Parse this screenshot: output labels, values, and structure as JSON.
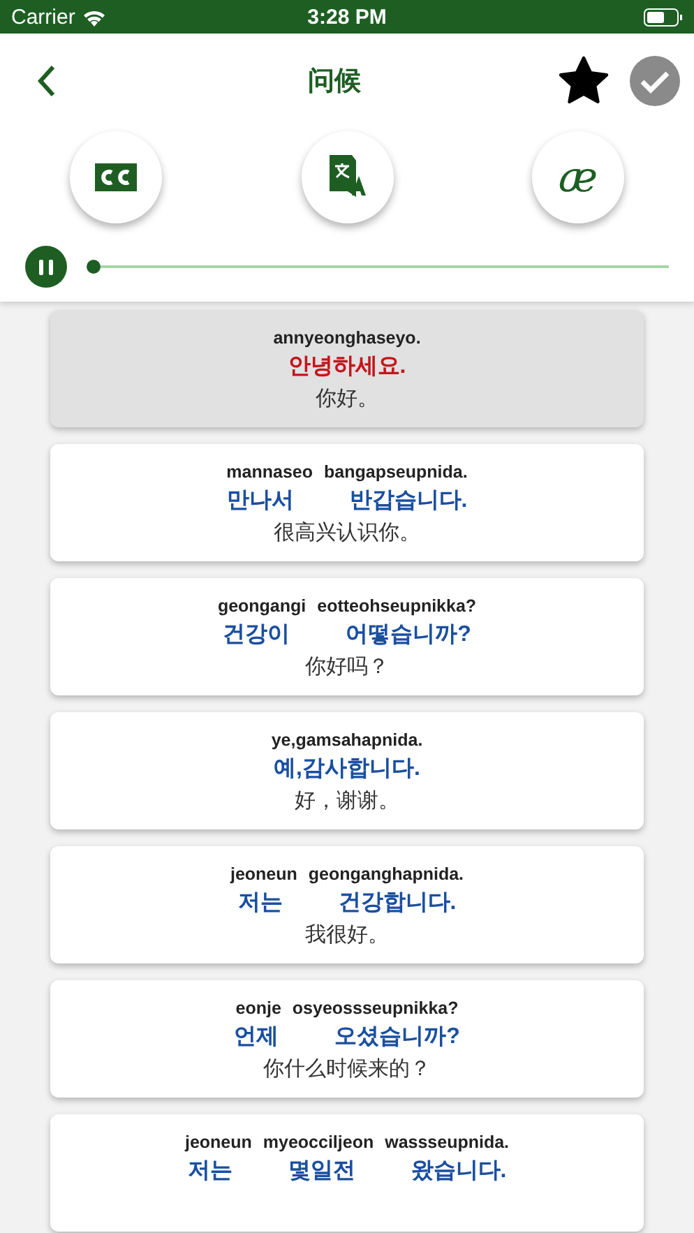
{
  "status_bar": {
    "carrier": "Carrier",
    "time": "3:28 PM"
  },
  "header": {
    "title": "问候",
    "favorite": true,
    "complete_disabled": true
  },
  "tools": [
    {
      "kind": "captions"
    },
    {
      "kind": "translate"
    },
    {
      "kind": "phonetic",
      "label": "æ"
    }
  ],
  "player": {
    "playing": true,
    "level": 0
  },
  "phrases": [
    {
      "selected": true,
      "romanization": [
        "annyeonghaseyo."
      ],
      "korean": [
        "안녕하세요."
      ],
      "translation": "你好。"
    },
    {
      "selected": false,
      "romanization": [
        "mannaseo",
        "bangapseupnida."
      ],
      "korean": [
        "만나서",
        "반갑습니다."
      ],
      "translation": "很高兴认识你。"
    },
    {
      "selected": false,
      "romanization": [
        "geongangi",
        "eotteohseupnikka?"
      ],
      "korean": [
        "건강이",
        "어떻습니까?"
      ],
      "translation": "你好吗？"
    },
    {
      "selected": false,
      "romanization": [
        "ye,gamsahapnida."
      ],
      "korean": [
        "예,감사합니다."
      ],
      "translation": "好，谢谢。"
    },
    {
      "selected": false,
      "romanization": [
        "jeoneun",
        "geonganghapnida."
      ],
      "korean": [
        "저는",
        "건강합니다."
      ],
      "translation": "我很好。"
    },
    {
      "selected": false,
      "romanization": [
        "eonje",
        "osyeossseupnikka?"
      ],
      "korean": [
        "언제",
        "오셨습니까?"
      ],
      "translation": "你什么时候来的？"
    },
    {
      "selected": false,
      "romanization": [
        "jeoneun",
        "myeocciljeon",
        "wassseupnida."
      ],
      "korean": [
        "저는",
        "몇일전",
        "왔습니다."
      ]
    }
  ]
}
